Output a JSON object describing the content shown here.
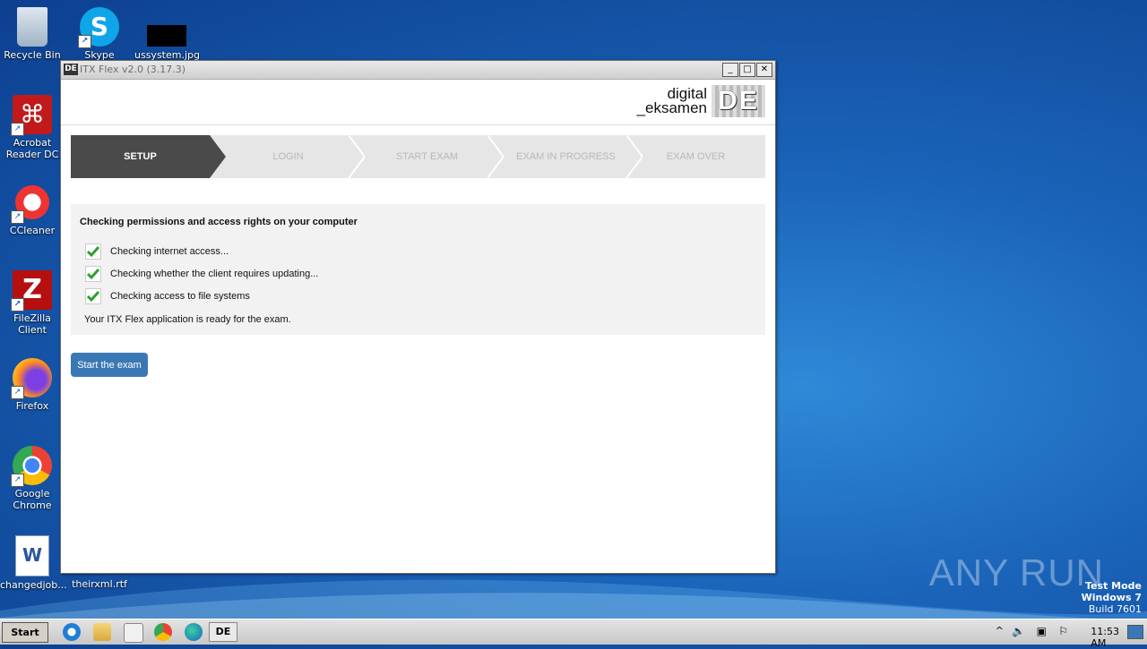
{
  "desktop": {
    "icons": [
      {
        "label": "Recycle Bin"
      },
      {
        "label": "Skype"
      },
      {
        "label": "ussystem.jpg"
      },
      {
        "label": "Acrobat Reader DC"
      },
      {
        "label": "CCleaner"
      },
      {
        "label": "FileZilla Client"
      },
      {
        "label": "Firefox"
      },
      {
        "label": "Google Chrome"
      },
      {
        "label": "changedjob..."
      },
      {
        "label": "theirxml.rtf"
      }
    ],
    "watermark": "ANY RUN",
    "test_mode": {
      "line1": "Test Mode",
      "line2": "Windows 7",
      "line3": "Build 7601"
    }
  },
  "window": {
    "app_icon_text": "DE",
    "title": "ITX Flex v2.0 (3.17.3)",
    "brand": {
      "line1": "digital",
      "line2": "_eksamen",
      "logo": "DE"
    },
    "steps": [
      {
        "label": "SETUP"
      },
      {
        "label": "LOGIN"
      },
      {
        "label": "START EXAM"
      },
      {
        "label": "EXAM IN PROGRESS"
      },
      {
        "label": "EXAM OVER"
      }
    ],
    "panel": {
      "heading": "Checking permissions and access rights on your computer",
      "checks": [
        {
          "label": "Checking internet access..."
        },
        {
          "label": "Checking whether the client requires updating..."
        },
        {
          "label": "Checking access to file systems"
        }
      ],
      "ready_text": "Your ITX Flex application is ready for the exam."
    },
    "start_button": "Start the exam"
  },
  "taskbar": {
    "start_label": "Start",
    "de_label": "DE",
    "clock": "11:53 AM"
  },
  "colors": {
    "accent": "#3a78b5",
    "active_step": "#4a4a4a",
    "check": "#2aa12a"
  }
}
